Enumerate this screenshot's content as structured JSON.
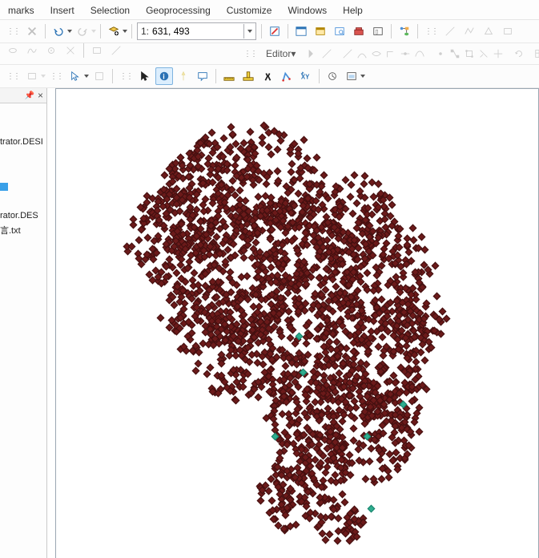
{
  "menubar": {
    "items": [
      "marks",
      "Insert",
      "Selection",
      "Geoprocessing",
      "Customize",
      "Windows",
      "Help"
    ]
  },
  "standard_toolbar": {
    "scale_prefix": "1:",
    "scale_value": "631, 493"
  },
  "editor": {
    "label": "Editor",
    "dropdown_glyph": "▾"
  },
  "toc": {
    "pin_glyph": "📌",
    "close_glyph": "×",
    "items": [
      {
        "label": "trator.DESI"
      },
      {
        "label": "",
        "style": "blue"
      },
      {
        "label": "rator.DES"
      },
      {
        "label": "言.txt"
      }
    ]
  },
  "tools_toolbar": {},
  "map": {
    "point_color": "#6b1a1a",
    "highlight_color": "#2fae8f"
  }
}
